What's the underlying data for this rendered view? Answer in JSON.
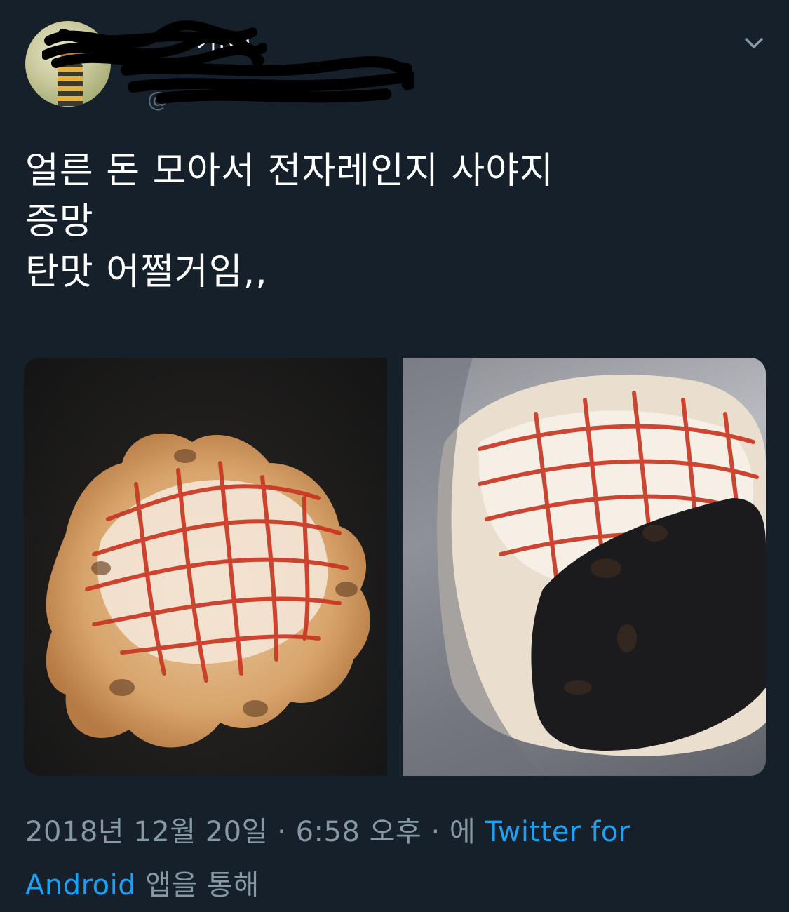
{
  "header": {
    "display_name_visible": "가IV)",
    "handle_visible": "@",
    "menu_icon": "chevron-down-icon"
  },
  "tweet": {
    "lines": [
      "얼른 돈 모아서 전자레인지 사야지",
      "증망",
      "탄맛 어쩔거임,,"
    ]
  },
  "media": {
    "count": 2,
    "icons": [
      "photo-cheese-bread",
      "photo-burnt-bread"
    ]
  },
  "footer": {
    "date": "2018년 12월 20일",
    "separator": " · ",
    "time": "6:58 오후",
    "prefix": "에 ",
    "client_link_1": "Twitter for",
    "client_link_2": "Android",
    "suffix": " 앱을 통해"
  },
  "colors": {
    "background": "#15202b",
    "text": "#ffffff",
    "meta": "#8899a6",
    "link": "#1da1f2"
  }
}
